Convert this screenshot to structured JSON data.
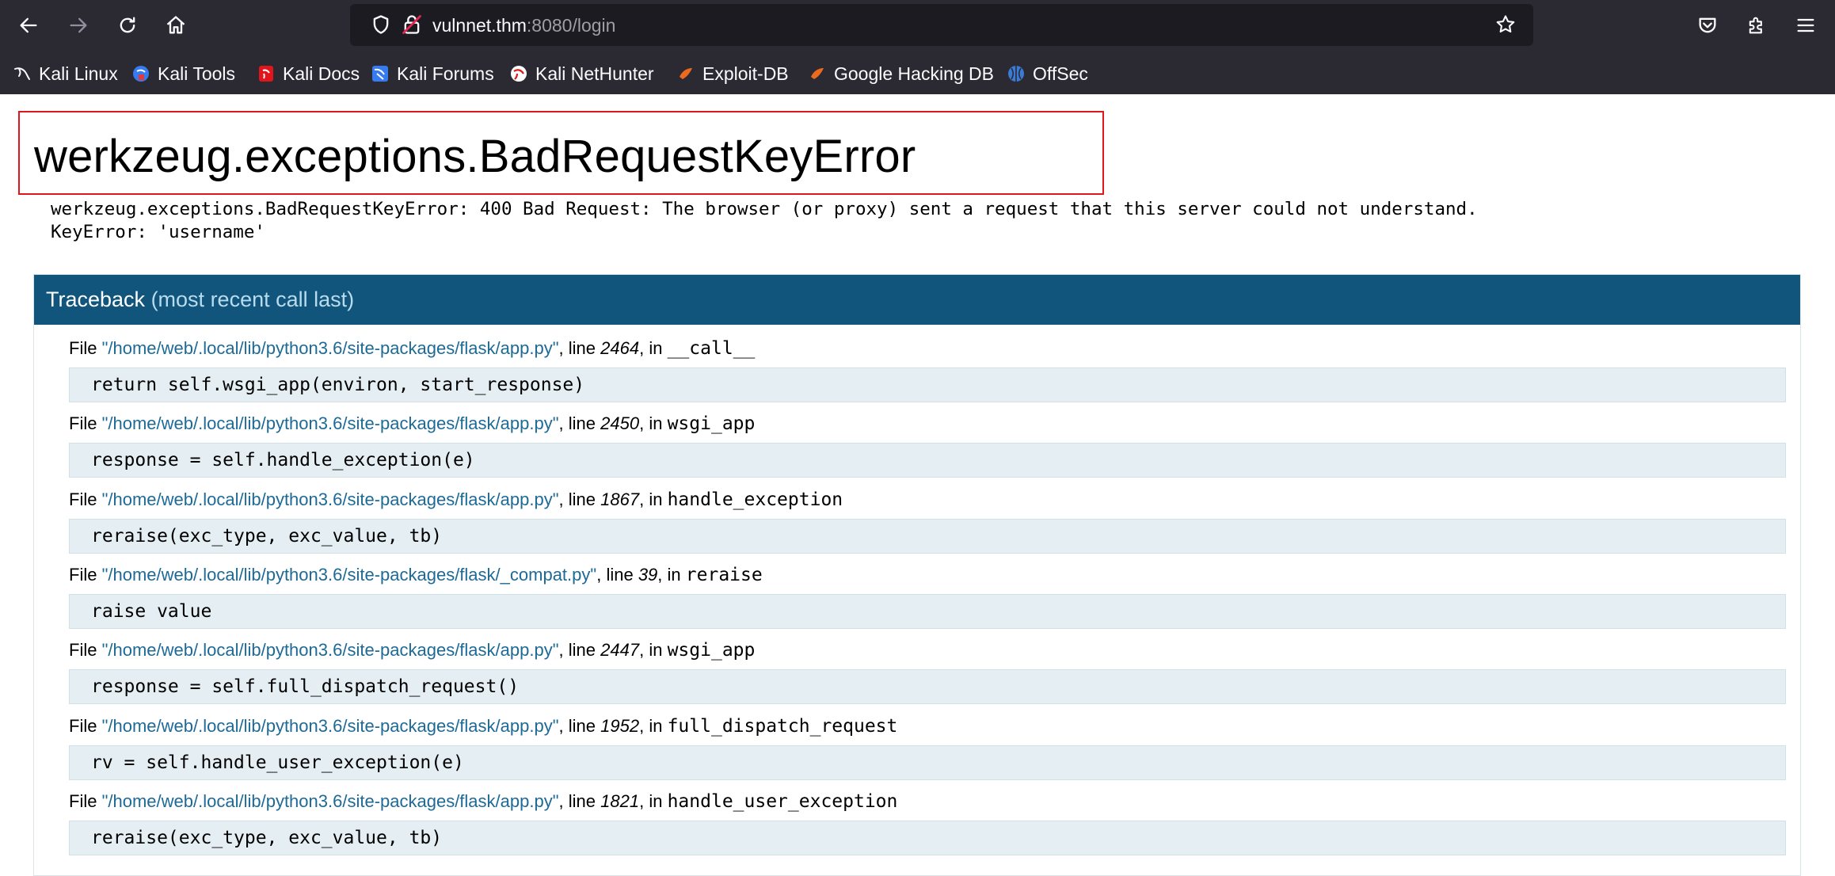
{
  "browser": {
    "url_host": "vulnnet.thm",
    "url_rest": ":8080/login",
    "bookmarks": [
      {
        "label": "Kali Linux",
        "icon": "kali-dragon-icon"
      },
      {
        "label": "Kali Tools",
        "icon": "kali-tools-icon"
      },
      {
        "label": "Kali Docs",
        "icon": "kali-docs-icon"
      },
      {
        "label": "Kali Forums",
        "icon": "kali-forums-icon"
      },
      {
        "label": "Kali NetHunter",
        "icon": "kali-nethunter-icon"
      },
      {
        "label": "Exploit-DB",
        "icon": "exploit-db-icon"
      },
      {
        "label": "Google Hacking DB",
        "icon": "ghdb-icon"
      },
      {
        "label": "OffSec",
        "icon": "offsec-icon"
      }
    ],
    "colors": {
      "chrome": "#2b2a33",
      "urlbar": "#1c1b22"
    }
  },
  "page": {
    "title": "werkzeug.exceptions.BadRequestKeyError",
    "error_line1": "werkzeug.exceptions.BadRequestKeyError: 400 Bad Request: The browser (or proxy) sent a request that this server could not understand.",
    "error_line2": "KeyError: 'username'",
    "traceback_label": "Traceback",
    "traceback_sub": "(most recent call last)",
    "file_word": "File",
    "line_word": "line",
    "in_word": "in",
    "frames": [
      {
        "file": "\"/home/web/.local/lib/python3.6/site-packages/flask/app.py\"",
        "line": "2464",
        "func": "__call__",
        "code": "return self.wsgi_app(environ, start_response)"
      },
      {
        "file": "\"/home/web/.local/lib/python3.6/site-packages/flask/app.py\"",
        "line": "2450",
        "func": "wsgi_app",
        "code": "response = self.handle_exception(e)"
      },
      {
        "file": "\"/home/web/.local/lib/python3.6/site-packages/flask/app.py\"",
        "line": "1867",
        "func": "handle_exception",
        "code": "reraise(exc_type, exc_value, tb)"
      },
      {
        "file": "\"/home/web/.local/lib/python3.6/site-packages/flask/_compat.py\"",
        "line": "39",
        "func": "reraise",
        "code": "raise value"
      },
      {
        "file": "\"/home/web/.local/lib/python3.6/site-packages/flask/app.py\"",
        "line": "2447",
        "func": "wsgi_app",
        "code": "response = self.full_dispatch_request()"
      },
      {
        "file": "\"/home/web/.local/lib/python3.6/site-packages/flask/app.py\"",
        "line": "1952",
        "func": "full_dispatch_request",
        "code": "rv = self.handle_user_exception(e)"
      },
      {
        "file": "\"/home/web/.local/lib/python3.6/site-packages/flask/app.py\"",
        "line": "1821",
        "func": "handle_user_exception",
        "code": "reraise(exc_type, exc_value, tb)"
      }
    ],
    "colors": {
      "traceback_header": "#11557c",
      "code_bg": "#e5eff3",
      "file_link": "#1d6a96",
      "title_outline": "#e0161b"
    }
  }
}
